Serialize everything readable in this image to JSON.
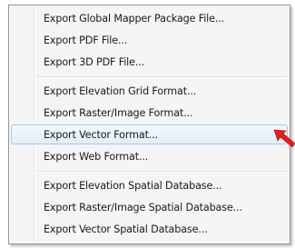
{
  "context_menu": {
    "groups": [
      {
        "items": [
          {
            "label": "Export Global Mapper Package File..."
          },
          {
            "label": "Export PDF File..."
          },
          {
            "label": "Export 3D PDF File..."
          }
        ]
      },
      {
        "items": [
          {
            "label": "Export Elevation Grid Format..."
          },
          {
            "label": "Export Raster/Image Format..."
          },
          {
            "label": "Export Vector Format...",
            "highlighted": true
          },
          {
            "label": "Export Web Format..."
          }
        ]
      },
      {
        "items": [
          {
            "label": "Export Elevation Spatial Database..."
          },
          {
            "label": "Export Raster/Image Spatial Database..."
          },
          {
            "label": "Export Vector Spatial Database..."
          }
        ]
      }
    ]
  },
  "pointer_annotation": {
    "icon": "red-arrow-icon",
    "color": "#e02020"
  }
}
